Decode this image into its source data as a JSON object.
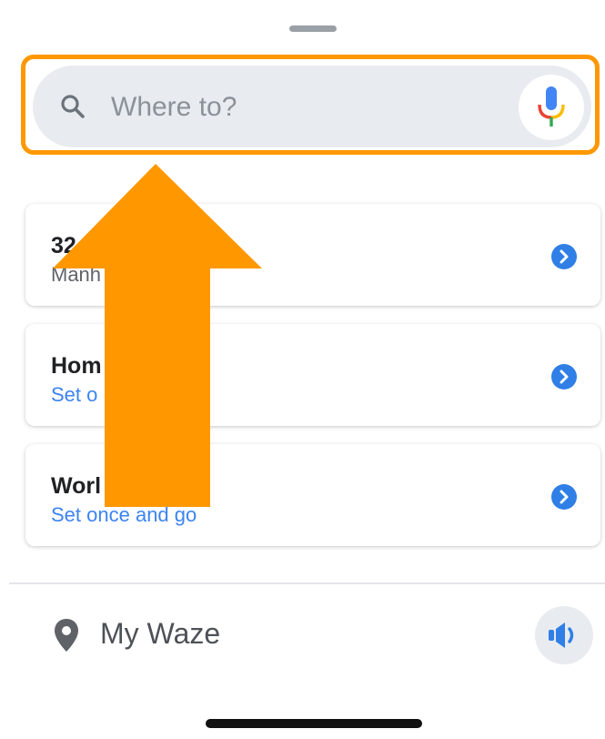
{
  "search": {
    "placeholder": "Where to?"
  },
  "cards": [
    {
      "title": "32",
      "subtitle": "Manh"
    },
    {
      "title": "Hom",
      "subtitle": "Set o",
      "subtitle_tail": "o"
    },
    {
      "title": "Worl",
      "subtitle": "Set once and go"
    }
  ],
  "bottom": {
    "label": "My Waze"
  },
  "colors": {
    "highlight": "#ff9800",
    "accent_blue": "#2f7fe6",
    "link_blue": "#3c84f0",
    "search_bg": "#e8ebef"
  },
  "icons": {
    "search": "search-icon",
    "mic": "microphone-icon",
    "chevron": "chevron-right-icon",
    "pin": "location-pin-icon",
    "sound": "speaker-icon"
  }
}
